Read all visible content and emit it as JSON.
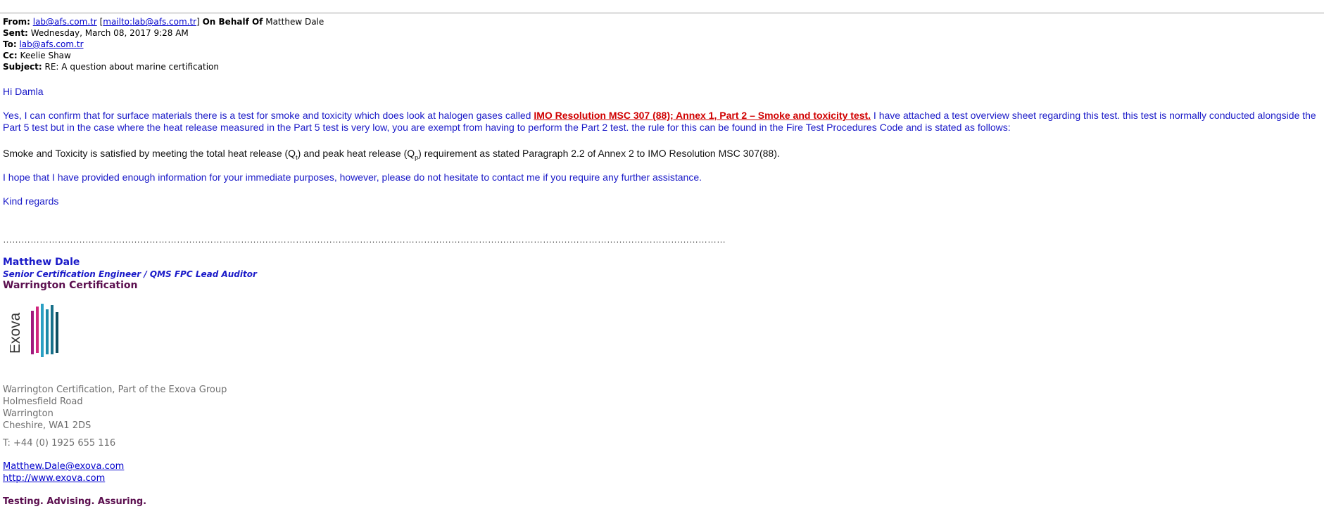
{
  "header": {
    "from_label": "From:",
    "from_email": "lab@afs.com.tr",
    "from_mailto": "mailto:lab@afs.com.tr",
    "on_behalf_label": "On Behalf Of",
    "on_behalf_name": "Matthew Dale",
    "sent_label": "Sent:",
    "sent_value": "Wednesday, March 08, 2017 9:28 AM",
    "to_label": "To:",
    "to_email": "lab@afs.com.tr",
    "cc_label": "Cc:",
    "cc_value": "Keelie Shaw",
    "subject_label": "Subject:",
    "subject_value": "RE: A question about marine certification"
  },
  "body": {
    "greeting": "Hi Damla",
    "p1_before": "Yes, I can confirm that for surface materials there is a test for smoke and toxicity which does look at halogen gases called ",
    "p1_link": "IMO Resolution MSC 307 (88); Annex 1, Part 2 – Smoke and toxicity test.",
    "p1_after": " I have attached a test overview sheet regarding this test. this test is normally conducted alongside the Part 5 test but in the case where the heat release measured in the Part 5 test is very low, you are exempt from having to perform the Part 2 test. the rule for this can be found in the Fire Test Procedures Code and is stated as follows:",
    "p2_a": "Smoke and Toxicity is satisfied by meeting the total heat release (Q",
    "p2_sub1": "t",
    "p2_b": ") and peak heat release (Q",
    "p2_sub2": "p",
    "p2_c": ") requirement as stated Paragraph 2.2 of Annex 2 to IMO Resolution MSC 307(88).",
    "p3": "I hope that I have provided enough information for your immediate purposes, however, please do not hesitate to contact me if you require any further assistance.",
    "closing": "Kind regards"
  },
  "signature": {
    "dots": "…………………………………………………………………………………………………………………………………………………………………………………………………………………",
    "name": "Matthew Dale",
    "title": "Senior Certification Engineer / QMS FPC Lead Auditor",
    "company": "Warrington Certification",
    "logo_text": "Exova",
    "address_1": "Warrington Certification, Part of the Exova Group",
    "address_2": "Holmesfield Road",
    "address_3": "Warrington",
    "address_4": "Cheshire, WA1 2DS",
    "phone": "T: +44 (0) 1925 655 116",
    "email": "Matthew.Dale@exova.com",
    "website": "http://www.exova.com",
    "tagline": "Testing. Advising. Assuring."
  },
  "colors": {
    "body_blue": "#1a1ac8",
    "link_red": "#d00000",
    "brand_purple": "#5b0f4f",
    "address_grey": "#6e6e6e"
  }
}
